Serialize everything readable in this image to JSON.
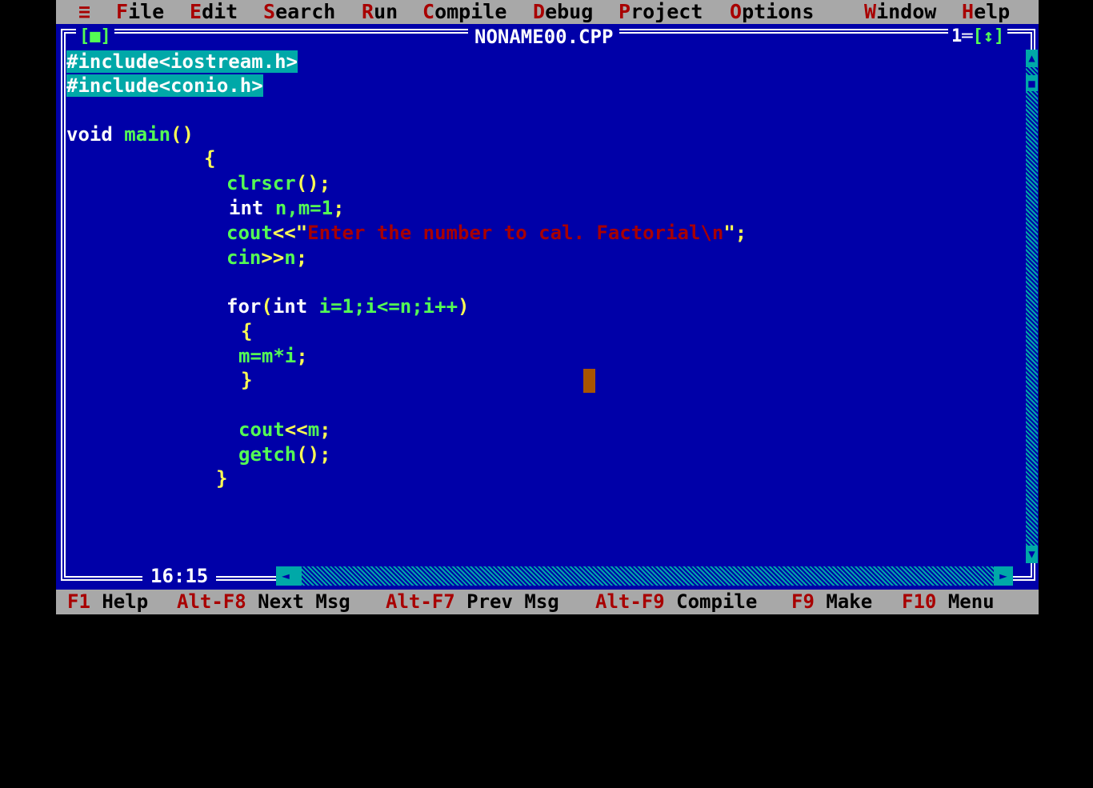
{
  "menu": {
    "system": "≡",
    "items": [
      {
        "hot": "F",
        "rest": "ile"
      },
      {
        "hot": "E",
        "rest": "dit"
      },
      {
        "hot": "S",
        "rest": "earch"
      },
      {
        "hot": "R",
        "rest": "un"
      },
      {
        "hot": "C",
        "rest": "ompile"
      },
      {
        "hot": "D",
        "rest": "ebug"
      },
      {
        "hot": "P",
        "rest": "roject"
      },
      {
        "hot": "O",
        "rest": "ptions"
      },
      {
        "hot": "W",
        "rest": "indow"
      },
      {
        "hot": "H",
        "rest": "elp"
      }
    ]
  },
  "window": {
    "title": "NONAME00.CPP",
    "close_box": "[■]",
    "number": "1",
    "zoom_box": "[↕]",
    "cursor_position": "16:15"
  },
  "code": {
    "l1": "#include<iostream.h>",
    "l2": "#include<conio.h>",
    "l4_kw": "void",
    "l4_fn": "main",
    "l4_p": "()",
    "l5": "{",
    "l6_fn": "clrscr",
    "l6_p": "();",
    "l7_kw": "int",
    "l7_v": "n,m=1",
    "l7_p": ";",
    "l8_fn": "cout",
    "l8_op": "<<",
    "l8_q1": "\"",
    "l8_str": "Enter the number to cal. Factorial\\n",
    "l8_q2": "\";",
    "l9_fn": "cin",
    "l9_op": ">>",
    "l9_v": "n",
    "l9_p": ";",
    "l11_kw": "for",
    "l11_p1": "(",
    "l11_kw2": "int",
    "l11_v": "i=1;i<=n;i++",
    "l11_p2": ")",
    "l12": "{",
    "l13_v": "m=m*i",
    "l13_p": ";",
    "l14": "}",
    "l16_fn": "cout",
    "l16_op": "<<",
    "l16_v": "m",
    "l16_p": ";",
    "l17_fn": "getch",
    "l17_p": "();",
    "l18": "}"
  },
  "status": {
    "f1_key": "F1",
    "f1_label": "Help",
    "altf8_key": "Alt-F8",
    "altf8_label": "Next Msg",
    "altf7_key": "Alt-F7",
    "altf7_label": "Prev Msg",
    "altf9_key": "Alt-F9",
    "altf9_label": "Compile",
    "f9_key": "F9",
    "f9_label": "Make",
    "f10_key": "F10",
    "f10_label": "Menu"
  },
  "colors": {
    "background": "#0000a8",
    "menu_bg": "#a8a8a8",
    "hotkey": "#a80000",
    "selection": "#00a8a8",
    "cursor": "#a85400"
  }
}
